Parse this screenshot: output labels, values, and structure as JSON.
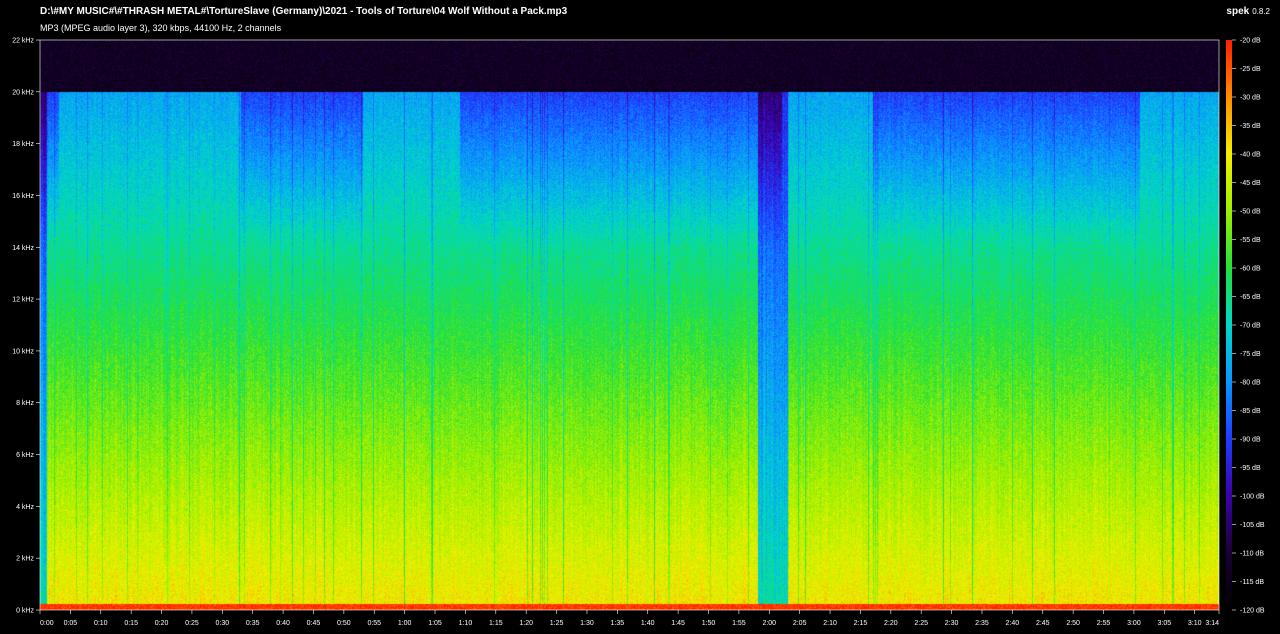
{
  "header": {
    "file_path": "D:\\#MY MUSIC#\\#THRASH METAL#\\TortureSlave (Germany)\\2021 - Tools of Torture\\04 Wolf Without a Pack.mp3",
    "file_info": "MP3 (MPEG audio layer 3), 320 kbps, 44100 Hz, 2 channels"
  },
  "brand": {
    "name": "spek",
    "version": "0.8.2"
  },
  "colors": {
    "background": "#000000",
    "text": "#ffffff",
    "palette": [
      "#000000",
      "#1a0033",
      "#3b00a8",
      "#1e3cff",
      "#0a96ff",
      "#00d8c8",
      "#22e03a",
      "#9cf000",
      "#f4f000",
      "#ff8c00",
      "#ff1e00"
    ]
  },
  "chart_data": {
    "type": "heatmap",
    "title": "",
    "x_axis": {
      "unit": "time (m:ss)",
      "range_seconds": [
        0,
        194
      ],
      "ticks": [
        "0:00",
        "0:05",
        "0:10",
        "0:15",
        "0:20",
        "0:25",
        "0:30",
        "0:35",
        "0:40",
        "0:45",
        "0:50",
        "0:55",
        "1:00",
        "1:05",
        "1:10",
        "1:15",
        "1:20",
        "1:25",
        "1:30",
        "1:35",
        "1:40",
        "1:45",
        "1:50",
        "1:55",
        "2:00",
        "2:05",
        "2:10",
        "2:15",
        "2:20",
        "2:25",
        "2:30",
        "2:35",
        "2:40",
        "2:45",
        "2:50",
        "2:55",
        "3:00",
        "3:05",
        "3:10",
        "3:14"
      ]
    },
    "y_axis": {
      "unit": "kHz",
      "range": [
        0,
        22
      ],
      "ticks": [
        "0 kHz",
        "2 kHz",
        "4 kHz",
        "6 kHz",
        "8 kHz",
        "10 kHz",
        "12 kHz",
        "14 kHz",
        "16 kHz",
        "18 kHz",
        "20 kHz",
        "22 kHz"
      ]
    },
    "color_scale": {
      "unit": "dB",
      "range": [
        -120,
        -20
      ],
      "ticks": [
        "-20 dB",
        "-25 dB",
        "-30 dB",
        "-35 dB",
        "-40 dB",
        "-45 dB",
        "-50 dB",
        "-55 dB",
        "-60 dB",
        "-65 dB",
        "-70 dB",
        "-75 dB",
        "-80 dB",
        "-85 dB",
        "-90 dB",
        "-95 dB",
        "-100 dB",
        "-105 dB",
        "-110 dB",
        "-115 dB",
        "-120 dB"
      ]
    },
    "approx_cutoff_khz": 20,
    "quiet_sections_seconds": [
      [
        0,
        1
      ],
      [
        118,
        123
      ]
    ],
    "full_band_sections_seconds": [
      [
        3,
        33
      ],
      [
        53,
        69
      ],
      [
        122,
        137
      ],
      [
        181,
        194
      ]
    ]
  }
}
